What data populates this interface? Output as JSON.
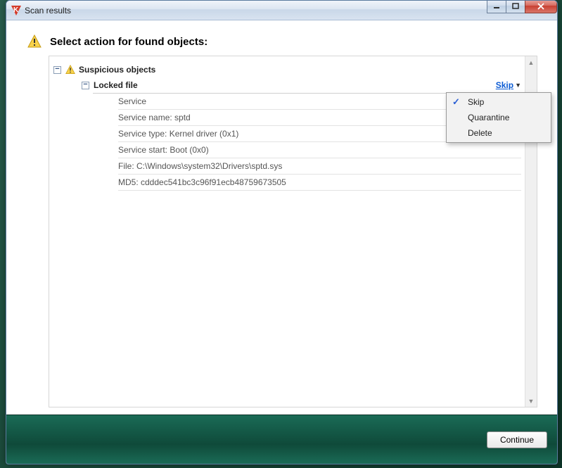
{
  "window": {
    "title": "Scan results"
  },
  "heading": "Select action for found objects:",
  "group": {
    "label": "Suspicious objects"
  },
  "item": {
    "label": "Locked file",
    "action_link": "Skip",
    "details": [
      "Service",
      "Service name: sptd",
      "Service type: Kernel driver (0x1)",
      "Service start: Boot (0x0)",
      "File: C:\\Windows\\system32\\Drivers\\sptd.sys",
      "MD5: cdddec541bc3c96f91ecb48759673505"
    ]
  },
  "menu": {
    "items": [
      "Skip",
      "Quarantine",
      "Delete"
    ],
    "selected_index": 0
  },
  "footer": {
    "continue": "Continue"
  }
}
